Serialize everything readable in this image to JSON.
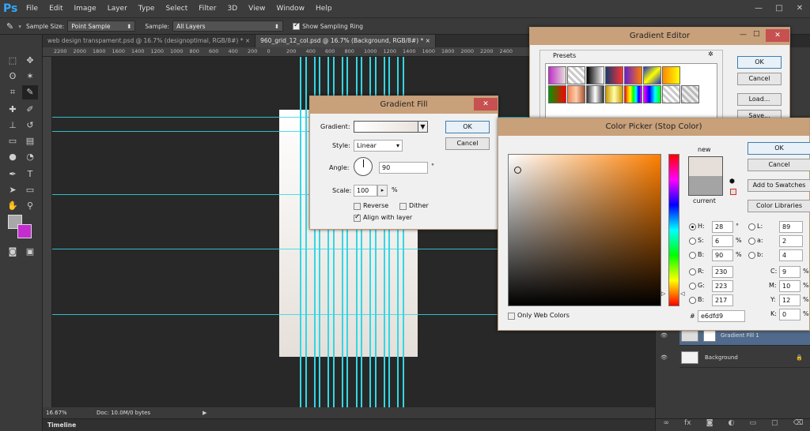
{
  "app": {
    "logo": "Ps",
    "menu": [
      "File",
      "Edit",
      "Image",
      "Layer",
      "Type",
      "Select",
      "Filter",
      "3D",
      "View",
      "Window",
      "Help"
    ],
    "window_min": "—",
    "window_max": "□",
    "window_close": "✕"
  },
  "options": {
    "sample_size_label": "Sample Size:",
    "sample_size_value": "Point Sample",
    "sample_label": "Sample:",
    "sample_value": "All Layers",
    "show_ring_label": "Show Sampling Ring"
  },
  "tabs": [
    {
      "label": "web design transpament.psd @ 16.7% (designoptimal, RGB/8#) *",
      "close": "×"
    },
    {
      "label": "960_grid_12_col.psd @ 16.7% (Background, RGB/8#) *",
      "close": "×"
    }
  ],
  "ruler": [
    "2200",
    "2000",
    "1800",
    "1600",
    "1400",
    "1200",
    "1000",
    "800",
    "600",
    "400",
    "200",
    "0",
    "200",
    "400",
    "600",
    "800",
    "1000",
    "1200",
    "1400",
    "1600",
    "1800",
    "2000",
    "2200",
    "2400"
  ],
  "status": {
    "zoom": "16.67%",
    "doc": "Doc: 10.0M/0 bytes",
    "timeline": "Timeline"
  },
  "layers": [
    {
      "name": "Gradient Fill 1"
    },
    {
      "name": "Background"
    }
  ],
  "gradient_editor": {
    "title": "Gradient Editor",
    "presets_label": "Presets",
    "ok": "OK",
    "cancel": "Cancel",
    "load": "Load...",
    "save": "Save..."
  },
  "gradient_fill": {
    "title": "Gradient Fill",
    "gradient_label": "Gradient:",
    "style_label": "Style:",
    "style_value": "Linear",
    "angle_label": "Angle:",
    "angle_value": "90",
    "angle_unit": "°",
    "scale_label": "Scale:",
    "scale_value": "100",
    "scale_unit": "%",
    "reverse": "Reverse",
    "dither": "Dither",
    "align": "Align with layer",
    "ok": "OK",
    "cancel": "Cancel"
  },
  "color_picker": {
    "title": "Color Picker (Stop Color)",
    "new_label": "new",
    "current_label": "current",
    "ok": "OK",
    "cancel": "Cancel",
    "add_swatches": "Add to Swatches",
    "libraries": "Color Libraries",
    "only_web": "Only Web Colors",
    "H": "28",
    "S": "6",
    "B": "90",
    "R": "230",
    "G": "223",
    "Bv": "217",
    "L": "89",
    "a": "2",
    "b": "4",
    "C": "9",
    "M": "10",
    "Y": "12",
    "K": "0",
    "hex": "e6dfd9",
    "lbl_H": "H:",
    "lbl_S": "S:",
    "lbl_B": "B:",
    "lbl_R": "R:",
    "lbl_G": "G:",
    "lbl_Bb": "B:",
    "lbl_L": "L:",
    "lbl_a": "a:",
    "lbl_b": "b:",
    "lbl_C": "C:",
    "lbl_M": "M:",
    "lbl_Y": "Y:",
    "lbl_K": "K:",
    "deg": "°",
    "pct": "%",
    "hash": "#",
    "new_color": "#e6dfd9",
    "current_color": "#a4a4a4"
  }
}
